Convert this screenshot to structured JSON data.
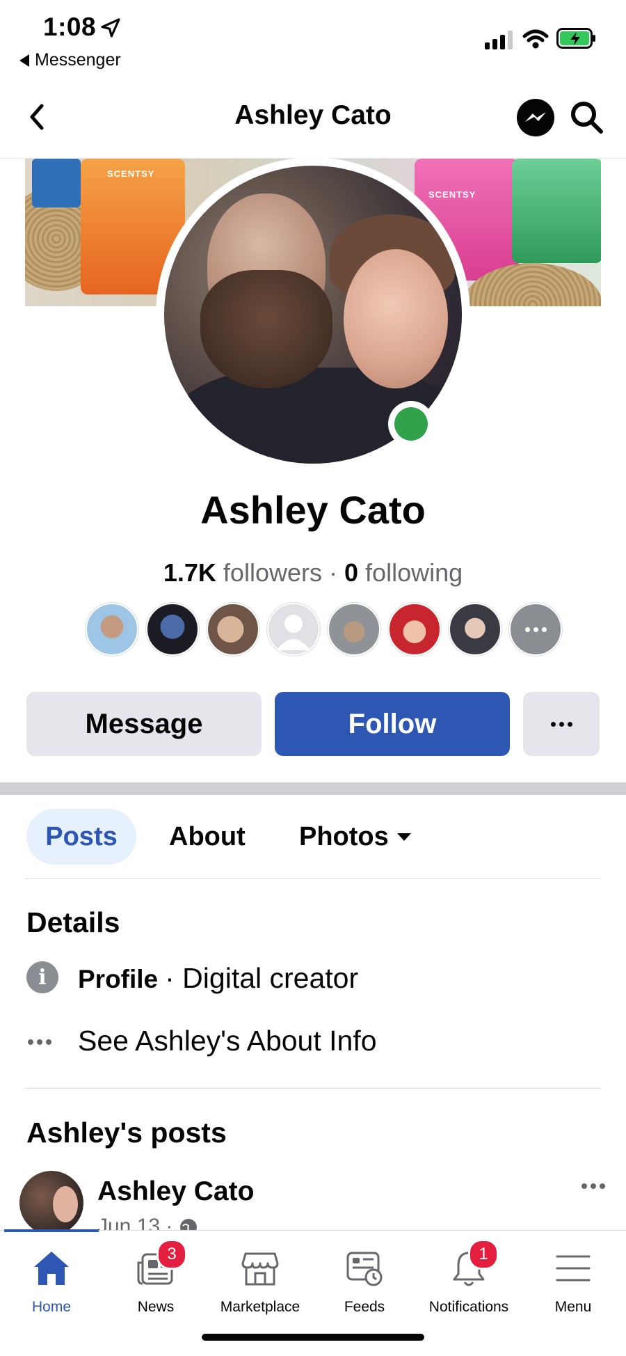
{
  "status_bar": {
    "time": "1:08",
    "back_app": "Messenger"
  },
  "header": {
    "title": "Ashley Cato"
  },
  "profile": {
    "name": "Ashley Cato",
    "followers_count": "1.7K",
    "followers_label": "followers",
    "following_count": "0",
    "following_label": "following",
    "cover_labels": [
      "SCENTSY",
      "SCENTSY"
    ]
  },
  "actions": {
    "message": "Message",
    "follow": "Follow"
  },
  "tabs": [
    {
      "label": "Posts",
      "active": true
    },
    {
      "label": "About",
      "active": false
    },
    {
      "label": "Photos",
      "active": false
    }
  ],
  "details": {
    "title": "Details",
    "profile_label": "Profile",
    "profile_type": "· Digital creator",
    "about_link": "See Ashley's About Info"
  },
  "posts": {
    "title": "Ashley's posts",
    "first_post": {
      "author": "Ashley Cato",
      "date": "Jun 13 · "
    }
  },
  "nav": [
    {
      "label": "Home",
      "icon": "home-icon",
      "active": true,
      "badge": ""
    },
    {
      "label": "News",
      "icon": "news-icon",
      "active": false,
      "badge": "3"
    },
    {
      "label": "Marketplace",
      "icon": "marketplace-icon",
      "active": false,
      "badge": ""
    },
    {
      "label": "Feeds",
      "icon": "feeds-icon",
      "active": false,
      "badge": ""
    },
    {
      "label": "Notifications",
      "icon": "bell-icon",
      "active": false,
      "badge": "1"
    },
    {
      "label": "Menu",
      "icon": "menu-icon",
      "active": false,
      "badge": ""
    }
  ],
  "colors": {
    "accent": "#2d57b3",
    "online": "#31a24c",
    "badge": "#e41e3f",
    "secondary_text": "#65676b"
  }
}
